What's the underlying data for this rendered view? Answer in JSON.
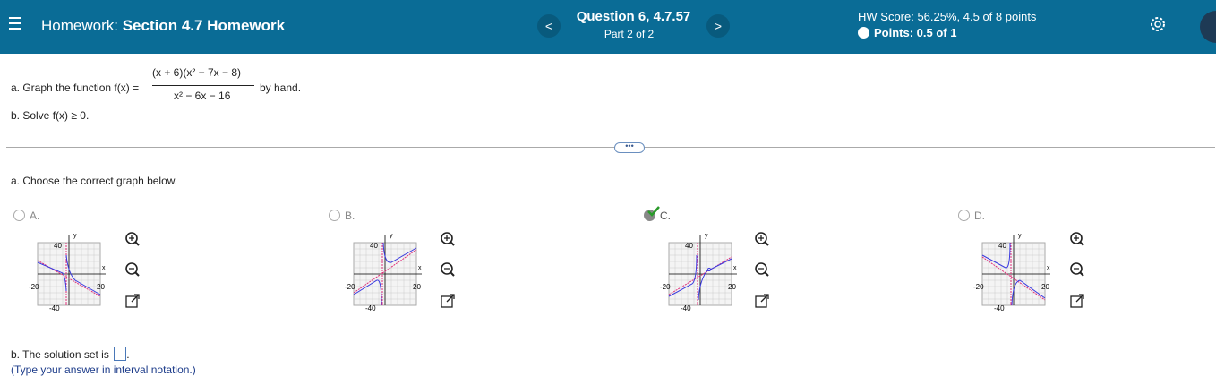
{
  "header": {
    "assignment_prefix": "Homework:",
    "assignment_name": "Section 4.7 Homework",
    "question_title": "Question 6, 4.7.57",
    "question_part": "Part 2 of 2",
    "prev_label": "<",
    "next_label": ">",
    "hw_score": "HW Score: 56.25%, 4.5 of 8 points",
    "points": "Points: 0.5 of 1"
  },
  "question": {
    "part_a_prefix": "a. Graph the function f(x) =",
    "numerator": "(x + 6)(x² − 7x − 8)",
    "denominator": "x² − 6x − 16",
    "part_a_suffix": "by hand.",
    "part_b": "b. Solve f(x) ≥ 0.",
    "more_label": "•••",
    "choose_prompt": "a. Choose the correct graph below.",
    "choices": [
      {
        "label": "A.",
        "selected": false
      },
      {
        "label": "B.",
        "selected": false
      },
      {
        "label": "C.",
        "selected": true
      },
      {
        "label": "D.",
        "selected": false
      }
    ],
    "graph_labels": {
      "y": "y",
      "x": "x",
      "ytop": "40",
      "ybot": "-40",
      "xleft": "-20",
      "xright": "20"
    },
    "solution_prefix": "b. The solution set is",
    "solution_suffix": ".",
    "hint": "(Type your answer in interval notation.)"
  },
  "colors": {
    "header_bg": "#0a6c96",
    "curve": "#3a3adf",
    "asymptote": "#e0307a",
    "correct_check": "#2a9a2a"
  }
}
